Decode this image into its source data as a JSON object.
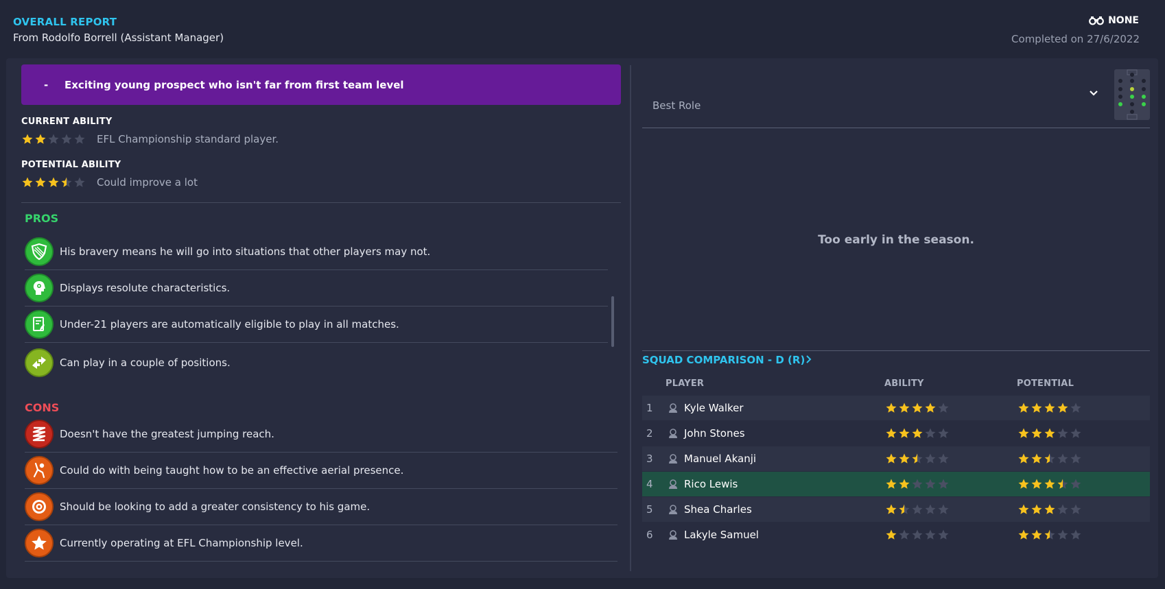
{
  "header": {
    "title": "OVERALL REPORT",
    "from": "From Rodolfo Borrell (Assistant Manager)",
    "scout_status": "NONE",
    "completed": "Completed on 27/6/2022"
  },
  "summary": {
    "dash": "-",
    "text": "Exciting young prospect who isn't far from first team level"
  },
  "current_ability": {
    "label": "CURRENT ABILITY",
    "stars": 2,
    "description": "EFL Championship standard player."
  },
  "potential_ability": {
    "label": "POTENTIAL ABILITY",
    "stars": 3.5,
    "description": "Could improve a lot"
  },
  "pros": {
    "title": "PROS",
    "items": [
      {
        "icon": "shield-icon",
        "text": "His bravery means he will go into situations that other players may not."
      },
      {
        "icon": "head-icon",
        "text": "Displays resolute characteristics."
      },
      {
        "icon": "document-icon",
        "text": "Under-21 players are automatically eligible to play in all matches."
      },
      {
        "icon": "swap-arrows-icon",
        "text": "Can play in a couple of positions."
      }
    ]
  },
  "cons": {
    "title": "CONS",
    "items": [
      {
        "icon": "spring-icon",
        "text": "Doesn't have the greatest jumping reach."
      },
      {
        "icon": "header-ball-icon",
        "text": "Could do with being taught how to be an effective aerial presence."
      },
      {
        "icon": "target-icon",
        "text": "Should be looking to add a greater consistency to his game."
      },
      {
        "icon": "star-icon",
        "text": "Currently operating at EFL Championship level."
      }
    ]
  },
  "best_role": {
    "label": "Best Role",
    "message": "Too early in the season."
  },
  "squad_comparison": {
    "title": "SQUAD COMPARISON - D (R)",
    "columns": {
      "player": "PLAYER",
      "ability": "ABILITY",
      "potential": "POTENTIAL"
    },
    "rows": [
      {
        "num": "1",
        "name": "Kyle Walker",
        "ability": 4,
        "potential": 4,
        "highlight": false
      },
      {
        "num": "2",
        "name": "John Stones",
        "ability": 3,
        "potential": 3,
        "highlight": false
      },
      {
        "num": "3",
        "name": "Manuel Akanji",
        "ability": 2.5,
        "potential": 2.5,
        "highlight": false
      },
      {
        "num": "4",
        "name": "Rico Lewis",
        "ability": 2,
        "potential": 3.5,
        "highlight": true
      },
      {
        "num": "5",
        "name": "Shea Charles",
        "ability": 1.5,
        "potential": 3,
        "highlight": false
      },
      {
        "num": "6",
        "name": "Lakyle Samuel",
        "ability": 1,
        "potential": 2.5,
        "highlight": false
      }
    ]
  },
  "colors": {
    "accent": "#2fc4ee",
    "pros": "#36d46c",
    "cons": "#ee4d57",
    "banner": "#661b98",
    "star": "#f7c21e",
    "star_empty": "#4a4f63",
    "highlight_row": "#1f5244"
  }
}
